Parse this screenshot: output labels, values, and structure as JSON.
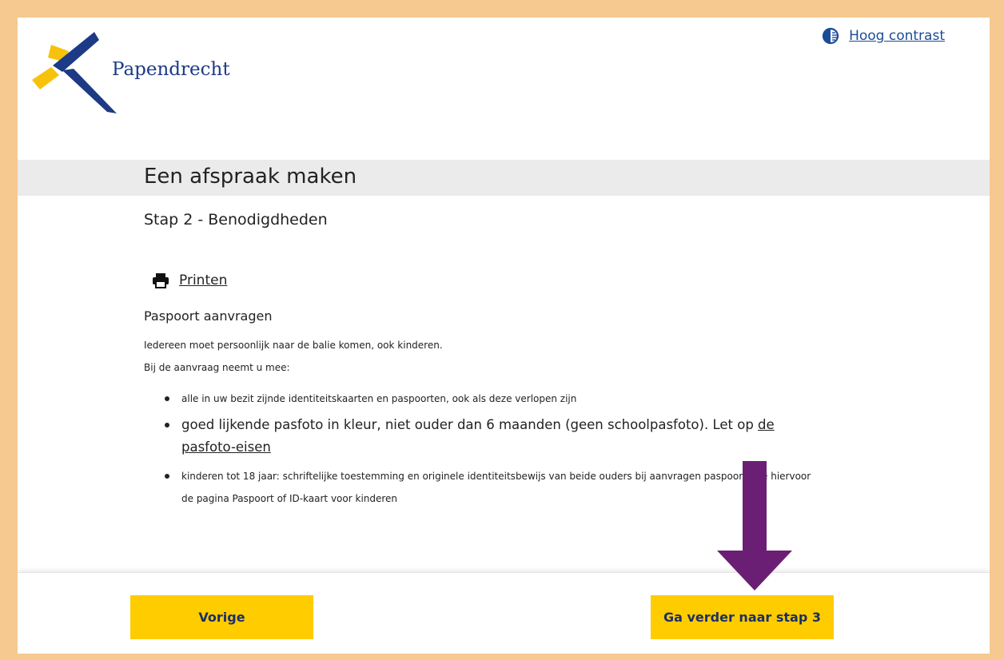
{
  "header": {
    "logo_text": "Papendrecht",
    "contrast_link": "Hoog contrast",
    "contrast_icon": "contrast-icon"
  },
  "main": {
    "page_title": "Een afspraak maken",
    "step_title": "Stap 2 - Benodigdheden",
    "print_link": "Printen",
    "print_icon": "printer-icon",
    "section_title": "Paspoort aanvragen",
    "paragraphs": [
      "Iedereen moet persoonlijk naar de balie komen, ook kinderen.",
      "Bij de aanvraag neemt u mee:"
    ],
    "requirements": [
      {
        "text": "alle in uw bezit zijnde identiteitskaarten en paspoorten, ook als deze verlopen zijn"
      },
      {
        "text": "goed lijkende pasfoto in kleur, niet ouder dan 6 maanden (geen schoolpasfoto). Let op ",
        "link": "de pasfoto-eisen"
      },
      {
        "text": "kinderen tot 18 jaar: schriftelijke toestemming en originele identiteitsbewijs van beide ouders bij aanvragen paspoort. Zie hiervoor de pagina Paspoort of ID-kaart voor kinderen"
      }
    ]
  },
  "footer": {
    "prev_label": "Vorige",
    "next_label": "Ga verder naar stap 3"
  },
  "colors": {
    "frame": "#f5c98f",
    "button": "#ffcc00",
    "button_text": "#1c2f66",
    "brand_blue": "#1c3a86",
    "brand_yellow": "#f7c20b",
    "arrow": "#6b1f74"
  }
}
